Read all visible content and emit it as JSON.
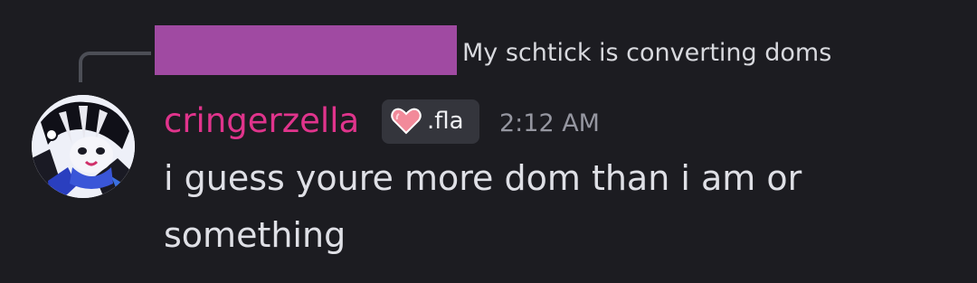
{
  "reply": {
    "text": "My schtick is converting doms"
  },
  "message": {
    "username": "cringerzella",
    "tag_label": ".fla",
    "tag_icon": "heart-icon",
    "timestamp": "2:12 AM",
    "lines": [
      "i guess youre more dom than i am or",
      "something"
    ]
  },
  "colors": {
    "background": "#1c1c21",
    "username": "#e0348c",
    "redaction": "#a04aa2",
    "timestamp": "#9596a0",
    "text": "#dfe0e6"
  }
}
